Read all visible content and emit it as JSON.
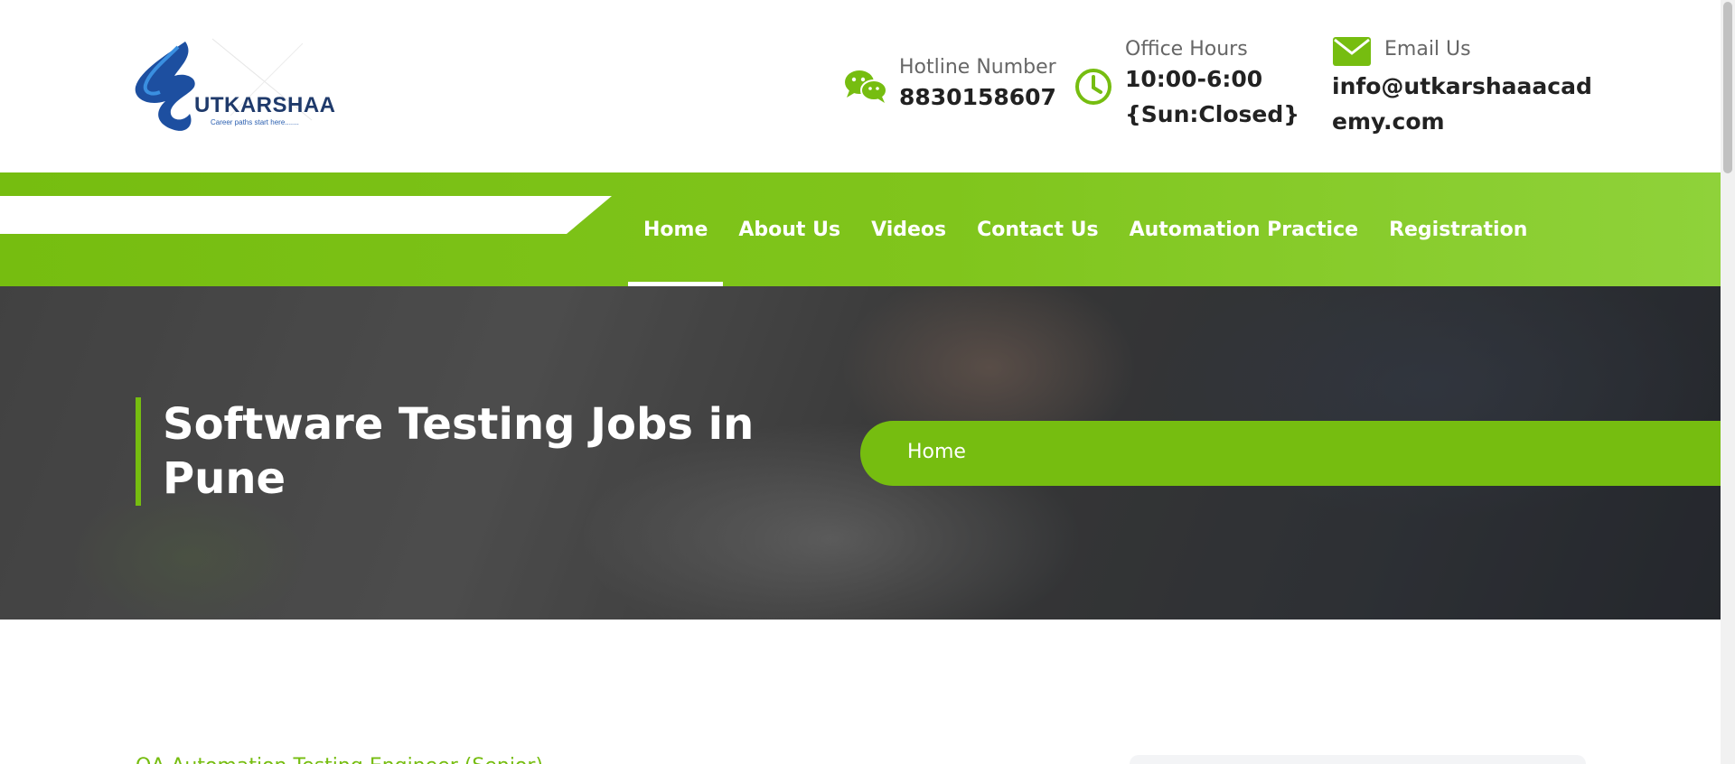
{
  "logo": {
    "name": "UTKARSHAA",
    "tagline": "Career paths start here......."
  },
  "contact": {
    "hotline_label": "Hotline Number",
    "hotline_value": "8830158607",
    "hours_label": "Office Hours",
    "hours_value": "10:00-6:00 {Sun:Closed}",
    "email_label": "Email Us",
    "email_value": "info@utkarshaaacademy.com"
  },
  "nav": {
    "items": [
      {
        "label": "Home",
        "active": true
      },
      {
        "label": "About Us",
        "active": false
      },
      {
        "label": "Videos",
        "active": false
      },
      {
        "label": "Contact Us",
        "active": false
      },
      {
        "label": "Automation Practice",
        "active": false
      },
      {
        "label": "Registration",
        "active": false
      }
    ]
  },
  "hero": {
    "title": "Software Testing Jobs in Pune",
    "breadcrumb": "Home"
  },
  "content": {
    "first_heading_partial": "QA Automation Testing Engineer (Senior)"
  },
  "colors": {
    "accent_green": "#76bd10",
    "logo_blue": "#1f3a6b",
    "white": "#ffffff"
  },
  "icons": {
    "hotline": "chat-bubbles-icon",
    "hours": "clock-icon",
    "email": "envelope-icon"
  }
}
